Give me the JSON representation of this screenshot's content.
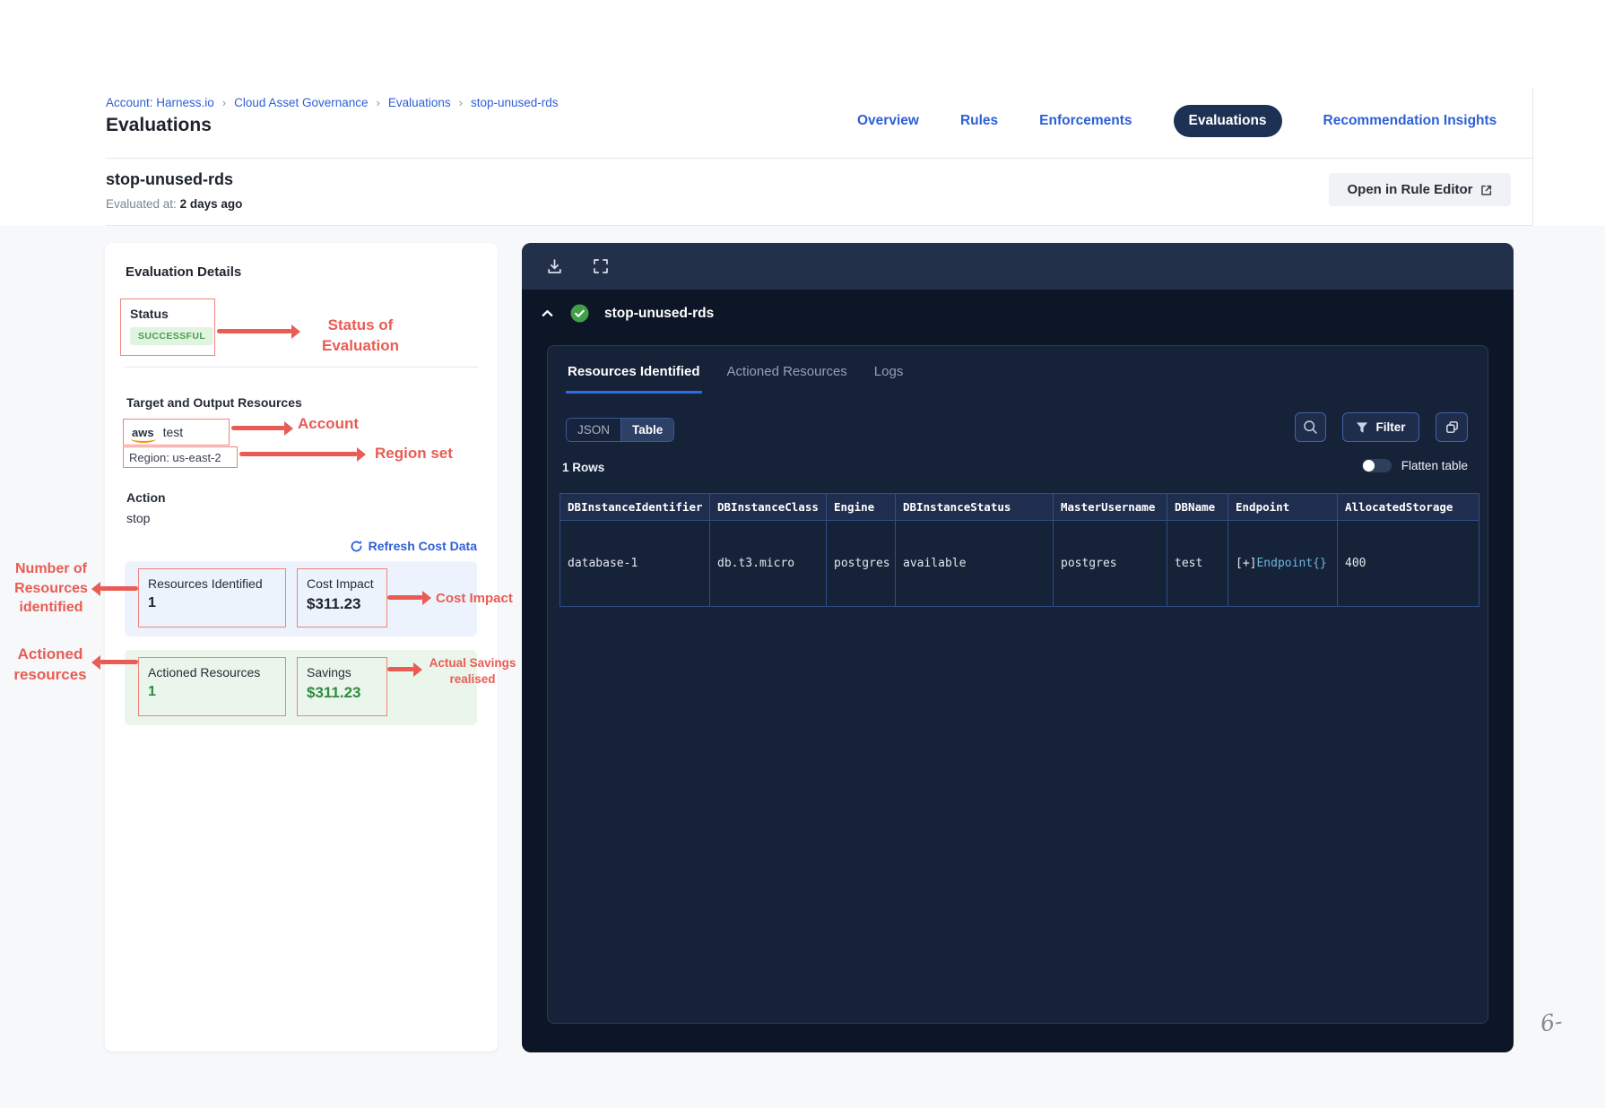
{
  "colors": {
    "accent_blue": "#2d5fd7",
    "annotation_red": "#e95c54",
    "success_green": "#46a04c",
    "savings_green": "#2e8b3f",
    "nav_pill_navy": "#1d3154",
    "panel_header_navy": "#233049",
    "panel_body_navy": "#0c1627",
    "panel_inner_navy": "#162238",
    "table_border_blue": "#2f4f83"
  },
  "breadcrumb": {
    "items": [
      "Account: Harness.io",
      "Cloud Asset Governance",
      "Evaluations",
      "stop-unused-rds"
    ],
    "separator": "›"
  },
  "page_title": "Evaluations",
  "nav": {
    "overview": "Overview",
    "rules": "Rules",
    "enforcements": "Enforcements",
    "evaluations": "Evaluations",
    "recommendation_insights": "Recommendation Insights"
  },
  "header": {
    "rule_name": "stop-unused-rds",
    "evaluated_label": "Evaluated at:",
    "evaluated_value": "2 days ago",
    "open_editor_label": "Open in Rule Editor"
  },
  "details": {
    "title": "Evaluation Details",
    "status_label": "Status",
    "status_value": "SUCCESSFUL",
    "target_title": "Target and Output Resources",
    "provider": "aws",
    "account_name": "test",
    "region": "Region: us-east-2",
    "action_label": "Action",
    "action_value": "stop",
    "refresh_label": "Refresh Cost Data",
    "stats": {
      "resources_label": "Resources Identified",
      "resources_value": "1",
      "cost_label": "Cost Impact",
      "cost_value": "$311.23",
      "actioned_label": "Actioned Resources",
      "actioned_value": "1",
      "savings_label": "Savings",
      "savings_value": "$311.23"
    }
  },
  "annotations": {
    "status": "Status of Evaluation",
    "account": "Account",
    "region": "Region set",
    "resources_identified": "Number of Resources identified",
    "cost_impact": "Cost Impact",
    "actioned": "Actioned resources",
    "savings": "Actual Savings realised"
  },
  "panel": {
    "title": "stop-unused-rds",
    "tabs": {
      "resources": "Resources Identified",
      "actioned": "Actioned Resources",
      "logs": "Logs"
    },
    "view_toggle": {
      "json": "JSON",
      "table": "Table",
      "selected": "Table"
    },
    "filter_label": "Filter",
    "rows_count": "1 Rows",
    "flatten_label": "Flatten table",
    "table": {
      "columns": [
        "DBInstanceIdentifier",
        "DBInstanceClass",
        "Engine",
        "DBInstanceStatus",
        "MasterUsername",
        "DBName",
        "Endpoint",
        "AllocatedStorage"
      ],
      "rows": [
        {
          "DBInstanceIdentifier": "database-1",
          "DBInstanceClass": "db.t3.micro",
          "Engine": "postgres",
          "DBInstanceStatus": "available",
          "MasterUsername": "postgres",
          "DBName": "test",
          "Endpoint": {
            "prefix": "[+]",
            "value": "Endpoint{}"
          },
          "AllocatedStorage": "400"
        }
      ]
    }
  },
  "decor": {
    "mark": "6-"
  }
}
